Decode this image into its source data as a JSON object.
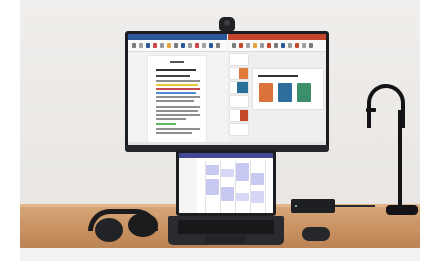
{
  "scene": {
    "monitor": {
      "left_app": "word-document",
      "right_app": "powerpoint-presentation"
    },
    "laptop": {
      "app": "calendar"
    },
    "objects": [
      "webcam",
      "monitor",
      "laptop",
      "headphones",
      "mouse",
      "docking-station",
      "desk-lamp"
    ]
  },
  "colors": {
    "wall": "#ece9e6",
    "desk": "#c9935f",
    "device_dark": "#1b1c1f",
    "word_accent": "#2b579a",
    "ppt_accent": "#c4462a",
    "calendar_accent": "#444791"
  }
}
